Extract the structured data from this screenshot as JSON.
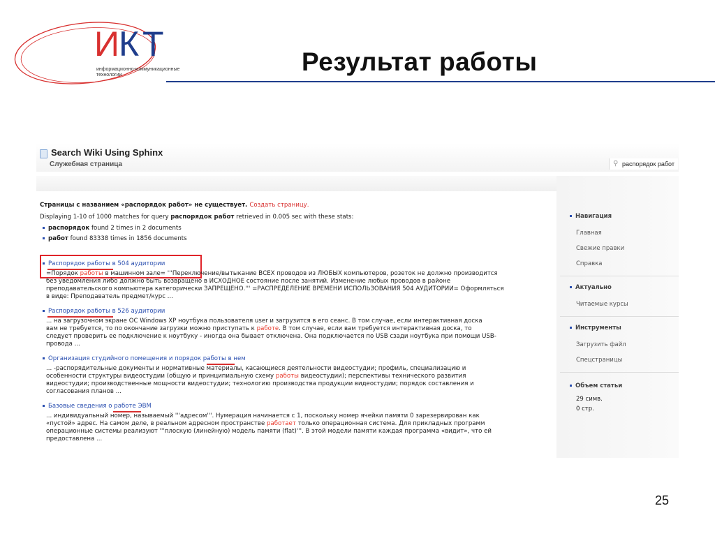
{
  "logo": {
    "letters": [
      "И",
      "К",
      "Т"
    ],
    "subtitle_line1": "информационно-коммуникационные",
    "subtitle_line2": "технологии",
    "colors": {
      "i": "#d8302f",
      "k": "#1f3d8c",
      "t": "#1f3d8c",
      "ellipse": "#d8302f"
    }
  },
  "slide": {
    "title": "Результат работы",
    "page_number": "25"
  },
  "wiki": {
    "title": "Search Wiki Using Sphinx",
    "subtitle": "Служебная страница",
    "search_value": "распорядок работ",
    "notice_prefix": "Страницы с названием «распорядок работ» не существует.",
    "notice_link": "Создать страницу.",
    "query_prefix": "Displaying 1-10 of 1000 matches for query",
    "query_term": "распорядок работ",
    "query_suffix": "retrieved in 0.005 sec with these stats:",
    "stats": [
      {
        "term": "распорядок",
        "text": "found 2 times in 2 documents"
      },
      {
        "term": "работ",
        "text": "found 83338 times in 1856 documents"
      }
    ],
    "results": [
      {
        "title_a": "Распорядок ",
        "title_hl": "работы",
        "title_b": " в 504 аудитории",
        "lines": [
          {
            "a": "=Порядок ",
            "hl": "работы",
            "b": " в машинном зале= '''Переключение/вытыкание ВСЕХ проводов из ЛЮБЫХ компьютеров, розеток не должно производится"
          },
          {
            "a": "без уведомления либо должно быть возвращено в ИСХОДНОЕ состояние после занятий. Изменение любых проводов в районе",
            "hl": "",
            "b": ""
          },
          {
            "a": "преподавательского компьютера категорически ЗАПРЕЩЕНО.''' =РАСПРЕДЕЛЕНИЕ ВРЕМЕНИ ИСПОЛЬЗОВАНИЯ 504 АУДИТОРИИ= Оформляться",
            "hl": "",
            "b": ""
          },
          {
            "a": "в виде: Преподаватель предмет/курс ...",
            "hl": "",
            "b": ""
          }
        ]
      },
      {
        "title_a": "Распорядок ",
        "title_hl": "работы",
        "title_b": " в 526 аудитории",
        "lines": [
          {
            "a": "... на загрузочном экране ОС Windows XP ноутбука пользователя user и загрузится в его сеанс. В том случае, если интерактивная доска",
            "hl": "",
            "b": ""
          },
          {
            "a": "вам не требуется, то по окончание загрузки можно приступать к ",
            "hl": "работе",
            "b": ". В том случае, если вам требуется интерактивная доска, то"
          },
          {
            "a": "следует проверить ее подключение к ноутбуку - иногда она бывает отключена. Она подключается по USB сзади ноутбука при помощи USB-",
            "hl": "",
            "b": ""
          },
          {
            "a": "провода ...",
            "hl": "",
            "b": ""
          }
        ]
      },
      {
        "title_a": "Организация студийного помещения и порядок ",
        "title_hl": "работы",
        "title_b": " в нем",
        "lines": [
          {
            "a": "... -распорядительные документы и нормативные материалы, касающиеся деятельности видеостудии; профиль, специализацию и",
            "hl": "",
            "b": ""
          },
          {
            "a": "особенности структуры видеостудии (общую и принципиальную схему ",
            "hl": "работы",
            "b": " видеостудии); перспективы технического развития"
          },
          {
            "a": "видеостудии; производственные мощности видеостудии; технологию производства продукции видеостудии; порядок составления и",
            "hl": "",
            "b": ""
          },
          {
            "a": "согласования планов ...",
            "hl": "",
            "b": ""
          }
        ]
      },
      {
        "title_a": "Базовые сведения о ",
        "title_hl": "работе",
        "title_b": " ЭВМ",
        "lines": [
          {
            "a": "... индивидуальный номер, называемый '''адресом'''. Нумерация начинается с 1, поскольку номер ячейки памяти 0 зарезервирован как",
            "hl": "",
            "b": ""
          },
          {
            "a": "«пустой» адрес. На самом деле, в реальном адресном пространстве ",
            "hl": "работает",
            "b": " только операционная система. Для прикладных программ"
          },
          {
            "a": "операционные системы реализуют '''плоскую (линейную) модель памяти (flat)'''. В этой модели памяти каждая программа «видит», что ей",
            "hl": "",
            "b": ""
          },
          {
            "a": "предоставлена ...",
            "hl": "",
            "b": ""
          }
        ]
      }
    ],
    "sidebar": {
      "navigation_title": "Навигация",
      "navigation_items": [
        "Главная",
        "Свежие правки",
        "Справка"
      ],
      "actual_title": "Актуально",
      "actual_items": [
        "Читаемые курсы"
      ],
      "tools_title": "Инструменты",
      "tools_items": [
        "Загрузить файл",
        "Спецстраницы"
      ],
      "size_title": "Объем статьи",
      "size_items": [
        "29 симв.",
        "0 стр."
      ]
    }
  }
}
